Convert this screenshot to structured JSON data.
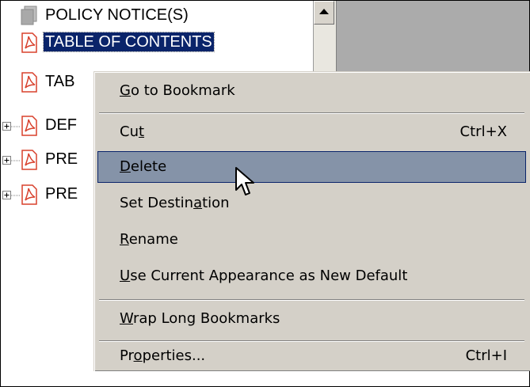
{
  "tree": {
    "items": [
      {
        "label": "POLICY NOTICE(S)",
        "icon": "document-icon",
        "expandable": false,
        "selected": false
      },
      {
        "label": "TABLE OF CONTENTS",
        "icon": "pdf-icon",
        "expandable": false,
        "selected": true
      },
      {
        "label": "TAB",
        "icon": "pdf-icon",
        "expandable": false,
        "selected": false
      },
      {
        "label": "DEF",
        "icon": "pdf-icon",
        "expandable": true,
        "selected": false
      },
      {
        "label": "PRE",
        "icon": "pdf-icon",
        "expandable": true,
        "selected": false
      },
      {
        "label": "PRE",
        "icon": "pdf-icon",
        "expandable": true,
        "selected": false
      }
    ]
  },
  "context_menu": {
    "items": [
      {
        "label": "Go to Bookmark",
        "mnemonic": "G",
        "shortcut": ""
      },
      {
        "label": "Cut",
        "mnemonic": "t",
        "shortcut": "Ctrl+X"
      },
      {
        "label": "Delete",
        "mnemonic": "D",
        "shortcut": "",
        "highlighted": true
      },
      {
        "label": "Set Destination",
        "mnemonic": "a",
        "shortcut": ""
      },
      {
        "label": "Rename",
        "mnemonic": "R",
        "shortcut": ""
      },
      {
        "label": "Use Current Appearance as New Default",
        "mnemonic": "U",
        "shortcut": ""
      },
      {
        "label": "Wrap Long Bookmarks",
        "mnemonic": "W",
        "shortcut": ""
      },
      {
        "label": "Properties...",
        "mnemonic": "o",
        "shortcut": "Ctrl+I"
      }
    ]
  },
  "colors": {
    "selection_bg": "#0a246a",
    "menu_bg": "#d4d0c8",
    "menu_highlight": "#8593a8",
    "pdf_red": "#d8402c"
  }
}
